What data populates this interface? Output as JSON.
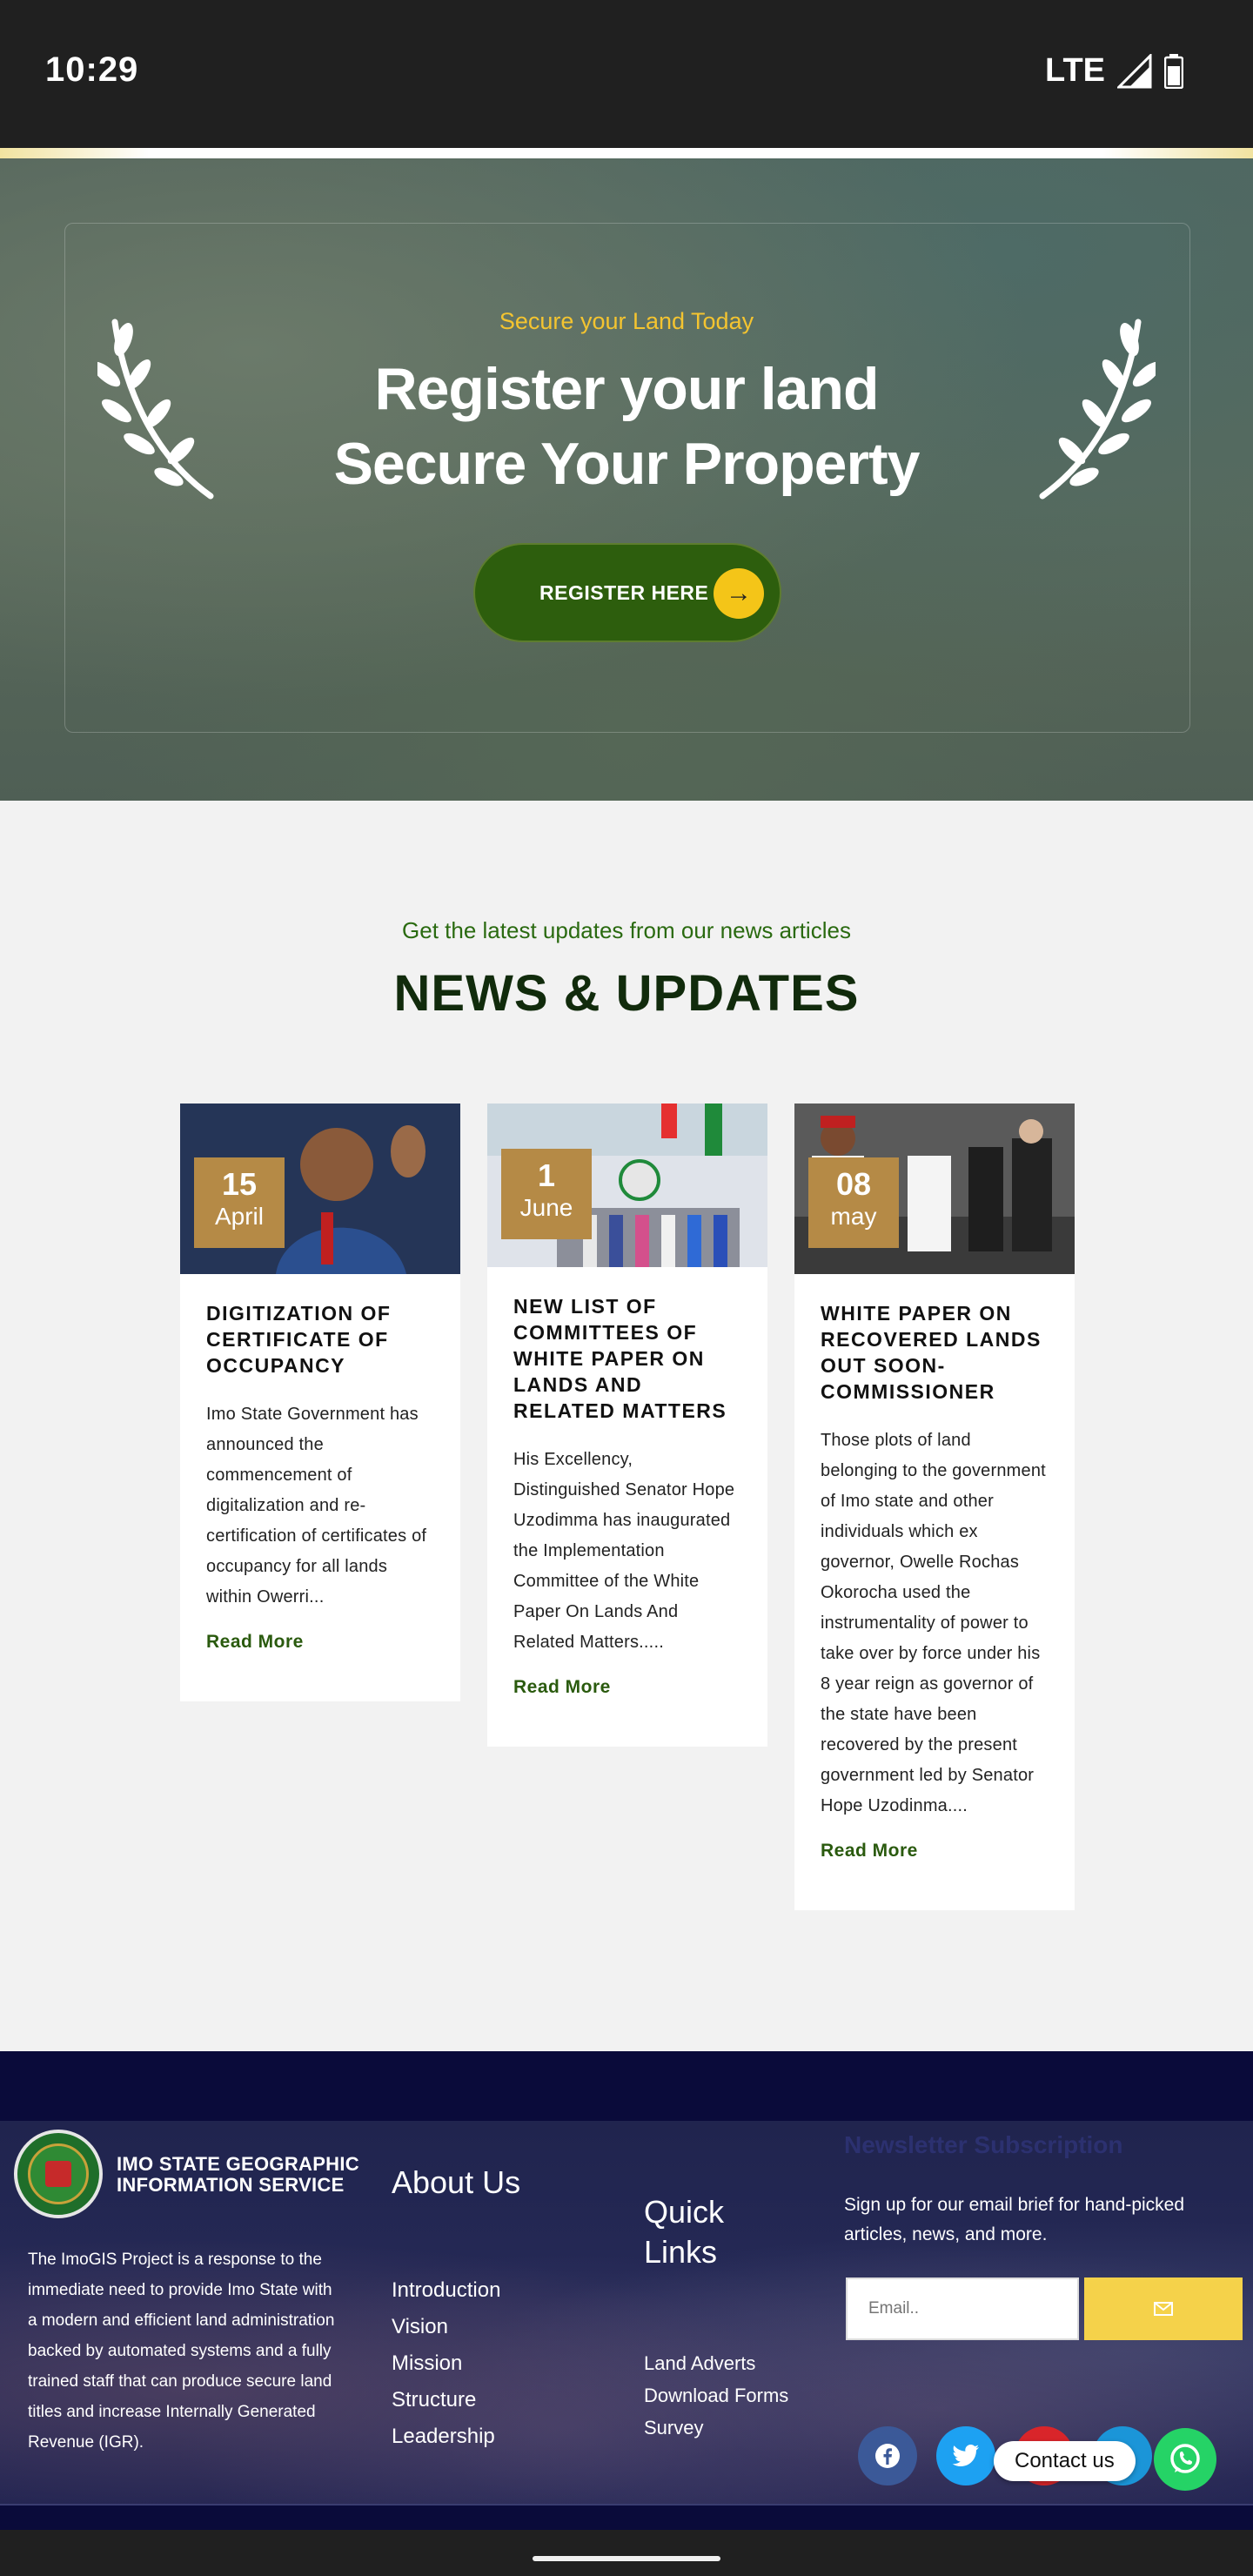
{
  "status_bar": {
    "time": "10:29",
    "network": "LTE"
  },
  "hero": {
    "eyebrow": "Secure your Land Today",
    "title_line1": "Register your land",
    "title_line2": "Secure Your Property",
    "button_label": "REGISTER HERE",
    "button_icon": "arrow-right-icon",
    "accent_color": "#f4c518",
    "button_color": "#2d5e0d"
  },
  "news": {
    "eyebrow": "Get the latest updates from our news articles",
    "title": "NEWS & UPDATES",
    "cards": [
      {
        "day": "15",
        "month": "April",
        "title": "DIGITIZATION OF CERTIFICATE OF OCCUPANCY",
        "excerpt": "Imo State Government has announced the commencement of digitalization and re-certification of certificates of occupancy for all lands within Owerri...",
        "read_more": "Read More"
      },
      {
        "day": "1",
        "month": "June",
        "title": "NEW LIST OF COMMITTEES OF WHITE PAPER ON LANDS AND RELATED MATTERS",
        "excerpt": "His Excellency, Distinguished Senator Hope Uzodimma has inaugurated the Implementation Committee of the White Paper On Lands And Related Matters.....",
        "read_more": "Read More"
      },
      {
        "day": "08",
        "month": "may",
        "title": "WHITE PAPER ON RECOVERED LANDS OUT SOON-COMMISSIONER",
        "excerpt": "Those plots of land belonging to the government of Imo state and other individuals which ex governor, Owelle Rochas Okorocha used the instrumentality of power to take over by force under his 8 year reign as governor of the state have been recovered by the present government led by Senator Hope Uzodinma....",
        "read_more": "Read More"
      }
    ]
  },
  "footer": {
    "org_line1": "IMO STATE GEOGRAPHIC",
    "org_line2": "INFORMATION SERVICE",
    "description": "The ImoGIS Project is a response to the immediate need to provide Imo State with a modern and efficient land administration backed by automated systems and a fully trained staff that can produce secure land titles and increase Internally Generated Revenue (IGR).",
    "about": {
      "title": "About Us",
      "links": [
        "Introduction",
        "Vision",
        "Mission",
        "Structure",
        "Leadership"
      ]
    },
    "quick": {
      "title_line1": "Quick",
      "title_line2": "Links",
      "links": [
        "Land Adverts",
        "Download Forms",
        "Survey"
      ]
    },
    "newsletter": {
      "title": "Newsletter Subscription",
      "text": "Sign up for our email brief for hand-picked articles, news, and more.",
      "email_placeholder": "Email..",
      "submit_icon": "envelope-icon"
    },
    "social": [
      "facebook-icon",
      "twitter-icon",
      "youtube-icon",
      "telegram-icon"
    ],
    "contact_label": "Contact us",
    "contact_icon": "whatsapp-icon"
  }
}
